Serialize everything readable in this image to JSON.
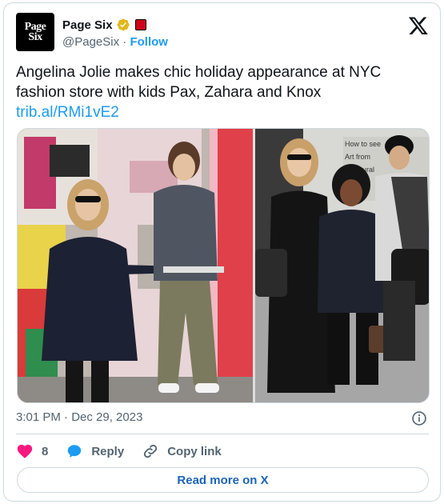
{
  "header": {
    "avatar_line1": "Page",
    "avatar_line2": "Six",
    "display_name": "Page Six",
    "handle": "@PageSix",
    "separator": "·",
    "follow_label": "Follow"
  },
  "tweet": {
    "text": "Angelina Jolie makes chic holiday appearance at NYC fashion store with kids Pax, Zahara and Knox",
    "link": "trib.al/RMi1vE2",
    "timestamp": "3:01 PM · Dec 29, 2023"
  },
  "media": {
    "sign_text_1": "How to see",
    "sign_text_2": "Art from",
    "sign_text_3": "PB mural"
  },
  "actions": {
    "like_count": "8",
    "reply_label": "Reply",
    "copy_label": "Copy link"
  },
  "footer": {
    "read_more_label": "Read more on X"
  },
  "colors": {
    "accent": "#1d9bf0",
    "like": "#f91880",
    "verified": "#e2b719",
    "border": "#cfd9de",
    "muted": "#536471"
  }
}
